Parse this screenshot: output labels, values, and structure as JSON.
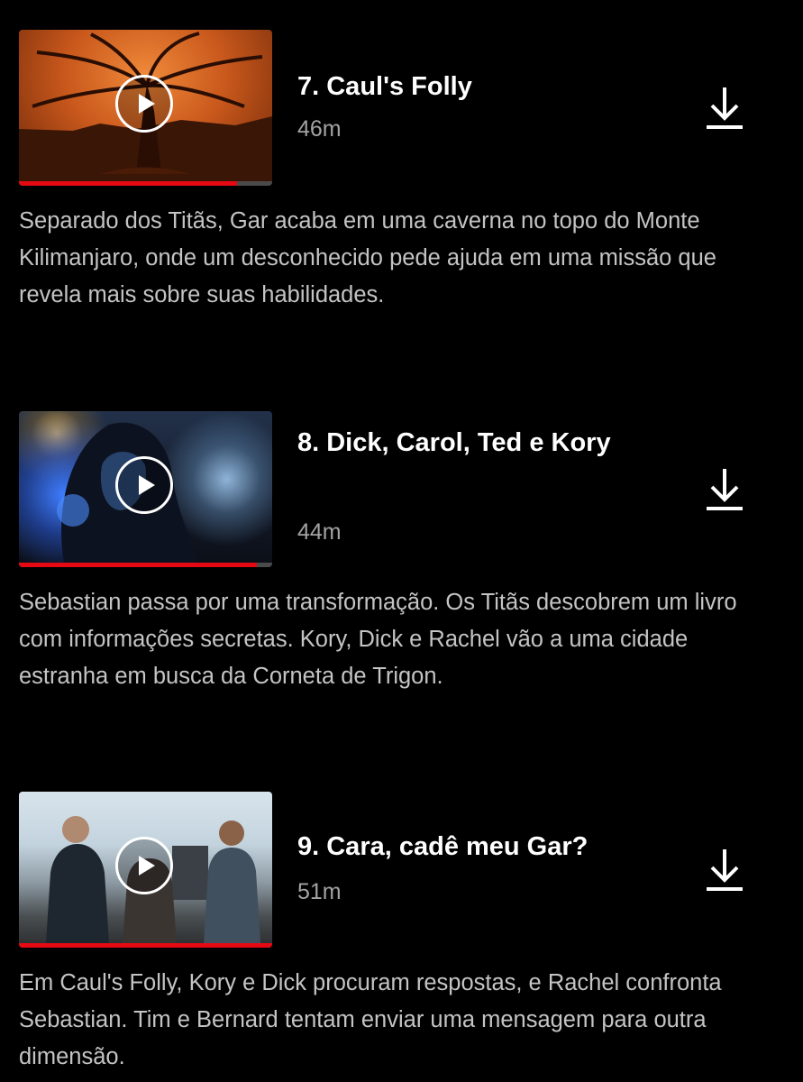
{
  "episodes": [
    {
      "title": "7. Caul's Folly",
      "duration": "46m",
      "synopsis": "Separado dos Titãs, Gar acaba em uma caverna no topo do Monte Kilimanjaro, onde um desconhecido pede ajuda em uma missão que revela mais sobre suas habilidades.",
      "progress_percent": 86
    },
    {
      "title": "8. Dick, Carol, Ted e Kory",
      "duration": "44m",
      "synopsis": "Sebastian passa por uma transformação. Os Titãs descobrem um livro com informações secretas. Kory, Dick e Rachel vão a uma cidade estranha em busca da Corneta de Trigon.",
      "progress_percent": 94
    },
    {
      "title": "9. Cara, cadê meu Gar?",
      "duration": "51m",
      "synopsis": "Em Caul's Folly, Kory e Dick procuram respostas, e Rachel confronta Sebastian. Tim e Bernard tentam enviar uma mensagem para outra dimensão.",
      "progress_percent": 100
    }
  ],
  "icons": {
    "play": "play-icon",
    "download": "download-icon"
  },
  "colors": {
    "background": "#000000",
    "progress": "#e50914",
    "progress_track": "#4a4a4a",
    "duration_text": "#a3a3a3",
    "synopsis_text": "#c4c4c4"
  }
}
